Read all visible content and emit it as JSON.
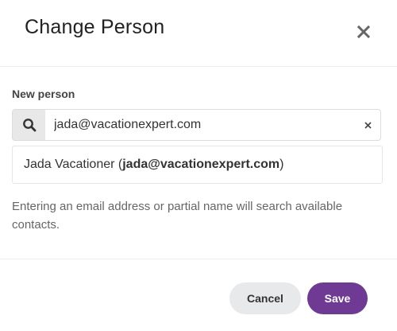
{
  "dialog": {
    "title": "Change Person",
    "close_icon": "close-icon"
  },
  "field": {
    "label": "New person",
    "search_icon": "search-icon",
    "value": "jada@vacationexpert.com",
    "clear_icon": "clear-icon"
  },
  "result": {
    "name": "Jada Vacationer",
    "open": " (",
    "email": "jada@vacationexpert.com",
    "close": ")"
  },
  "help_text": "Entering an email address or partial name will search available contacts.",
  "buttons": {
    "cancel": "Cancel",
    "save": "Save"
  },
  "colors": {
    "primary": "#6e3a93",
    "secondary_button": "#e8e9eb"
  }
}
